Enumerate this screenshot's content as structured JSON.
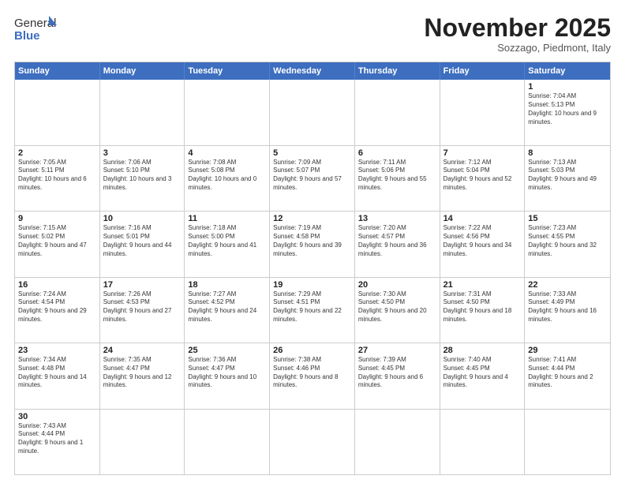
{
  "logo": {
    "text_general": "General",
    "text_blue": "Blue"
  },
  "header": {
    "month": "November 2025",
    "location": "Sozzago, Piedmont, Italy"
  },
  "weekdays": [
    "Sunday",
    "Monday",
    "Tuesday",
    "Wednesday",
    "Thursday",
    "Friday",
    "Saturday"
  ],
  "rows": [
    [
      {
        "day": "",
        "info": ""
      },
      {
        "day": "",
        "info": ""
      },
      {
        "day": "",
        "info": ""
      },
      {
        "day": "",
        "info": ""
      },
      {
        "day": "",
        "info": ""
      },
      {
        "day": "",
        "info": ""
      },
      {
        "day": "1",
        "info": "Sunrise: 7:04 AM\nSunset: 5:13 PM\nDaylight: 10 hours and 9 minutes."
      }
    ],
    [
      {
        "day": "2",
        "info": "Sunrise: 7:05 AM\nSunset: 5:11 PM\nDaylight: 10 hours and 6 minutes."
      },
      {
        "day": "3",
        "info": "Sunrise: 7:06 AM\nSunset: 5:10 PM\nDaylight: 10 hours and 3 minutes."
      },
      {
        "day": "4",
        "info": "Sunrise: 7:08 AM\nSunset: 5:08 PM\nDaylight: 10 hours and 0 minutes."
      },
      {
        "day": "5",
        "info": "Sunrise: 7:09 AM\nSunset: 5:07 PM\nDaylight: 9 hours and 57 minutes."
      },
      {
        "day": "6",
        "info": "Sunrise: 7:11 AM\nSunset: 5:06 PM\nDaylight: 9 hours and 55 minutes."
      },
      {
        "day": "7",
        "info": "Sunrise: 7:12 AM\nSunset: 5:04 PM\nDaylight: 9 hours and 52 minutes."
      },
      {
        "day": "8",
        "info": "Sunrise: 7:13 AM\nSunset: 5:03 PM\nDaylight: 9 hours and 49 minutes."
      }
    ],
    [
      {
        "day": "9",
        "info": "Sunrise: 7:15 AM\nSunset: 5:02 PM\nDaylight: 9 hours and 47 minutes."
      },
      {
        "day": "10",
        "info": "Sunrise: 7:16 AM\nSunset: 5:01 PM\nDaylight: 9 hours and 44 minutes."
      },
      {
        "day": "11",
        "info": "Sunrise: 7:18 AM\nSunset: 5:00 PM\nDaylight: 9 hours and 41 minutes."
      },
      {
        "day": "12",
        "info": "Sunrise: 7:19 AM\nSunset: 4:58 PM\nDaylight: 9 hours and 39 minutes."
      },
      {
        "day": "13",
        "info": "Sunrise: 7:20 AM\nSunset: 4:57 PM\nDaylight: 9 hours and 36 minutes."
      },
      {
        "day": "14",
        "info": "Sunrise: 7:22 AM\nSunset: 4:56 PM\nDaylight: 9 hours and 34 minutes."
      },
      {
        "day": "15",
        "info": "Sunrise: 7:23 AM\nSunset: 4:55 PM\nDaylight: 9 hours and 32 minutes."
      }
    ],
    [
      {
        "day": "16",
        "info": "Sunrise: 7:24 AM\nSunset: 4:54 PM\nDaylight: 9 hours and 29 minutes."
      },
      {
        "day": "17",
        "info": "Sunrise: 7:26 AM\nSunset: 4:53 PM\nDaylight: 9 hours and 27 minutes."
      },
      {
        "day": "18",
        "info": "Sunrise: 7:27 AM\nSunset: 4:52 PM\nDaylight: 9 hours and 24 minutes."
      },
      {
        "day": "19",
        "info": "Sunrise: 7:29 AM\nSunset: 4:51 PM\nDaylight: 9 hours and 22 minutes."
      },
      {
        "day": "20",
        "info": "Sunrise: 7:30 AM\nSunset: 4:50 PM\nDaylight: 9 hours and 20 minutes."
      },
      {
        "day": "21",
        "info": "Sunrise: 7:31 AM\nSunset: 4:50 PM\nDaylight: 9 hours and 18 minutes."
      },
      {
        "day": "22",
        "info": "Sunrise: 7:33 AM\nSunset: 4:49 PM\nDaylight: 9 hours and 16 minutes."
      }
    ],
    [
      {
        "day": "23",
        "info": "Sunrise: 7:34 AM\nSunset: 4:48 PM\nDaylight: 9 hours and 14 minutes."
      },
      {
        "day": "24",
        "info": "Sunrise: 7:35 AM\nSunset: 4:47 PM\nDaylight: 9 hours and 12 minutes."
      },
      {
        "day": "25",
        "info": "Sunrise: 7:36 AM\nSunset: 4:47 PM\nDaylight: 9 hours and 10 minutes."
      },
      {
        "day": "26",
        "info": "Sunrise: 7:38 AM\nSunset: 4:46 PM\nDaylight: 9 hours and 8 minutes."
      },
      {
        "day": "27",
        "info": "Sunrise: 7:39 AM\nSunset: 4:45 PM\nDaylight: 9 hours and 6 minutes."
      },
      {
        "day": "28",
        "info": "Sunrise: 7:40 AM\nSunset: 4:45 PM\nDaylight: 9 hours and 4 minutes."
      },
      {
        "day": "29",
        "info": "Sunrise: 7:41 AM\nSunset: 4:44 PM\nDaylight: 9 hours and 2 minutes."
      }
    ],
    [
      {
        "day": "30",
        "info": "Sunrise: 7:43 AM\nSunset: 4:44 PM\nDaylight: 9 hours and 1 minute."
      },
      {
        "day": "",
        "info": ""
      },
      {
        "day": "",
        "info": ""
      },
      {
        "day": "",
        "info": ""
      },
      {
        "day": "",
        "info": ""
      },
      {
        "day": "",
        "info": ""
      },
      {
        "day": "",
        "info": ""
      }
    ]
  ]
}
